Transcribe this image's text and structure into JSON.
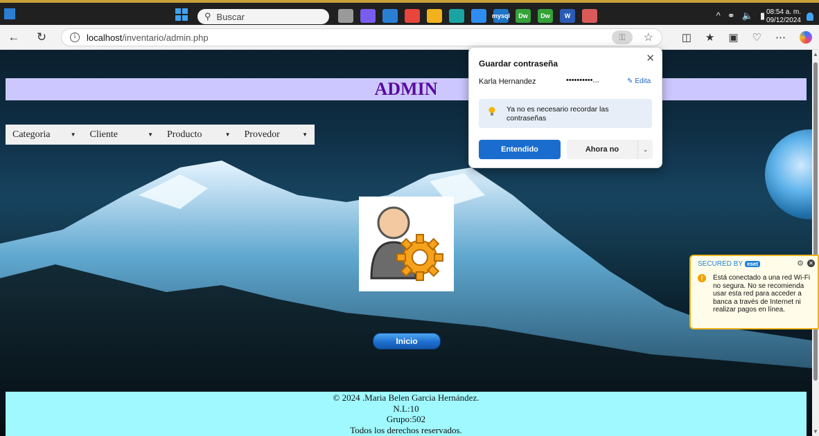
{
  "taskbar": {
    "search_placeholder": "Buscar",
    "clock_time": "08:54 a. m.",
    "clock_date": "09/12/2024",
    "apps": [
      {
        "name": "task-view-icon",
        "color": "#9a9a9a",
        "label": ""
      },
      {
        "name": "copilot-app-icon",
        "color": "#7a5cf0",
        "label": ""
      },
      {
        "name": "store-icon",
        "color": "#2a7fd4",
        "label": ""
      },
      {
        "name": "chrome-icon",
        "color": "#e8453c",
        "label": ""
      },
      {
        "name": "explorer-icon",
        "color": "#f2b21e",
        "label": ""
      },
      {
        "name": "edge-icon",
        "color": "#1aa3a3",
        "label": ""
      },
      {
        "name": "copilot-badge-icon",
        "color": "#2e8cf0",
        "label": ""
      },
      {
        "name": "mysql-icon",
        "color": "#1f74c6",
        "label": "mysql"
      },
      {
        "name": "dreamweaver-icon",
        "color": "#35a23a",
        "label": "Dw"
      },
      {
        "name": "dreamweaver-icon-2",
        "color": "#35a23a",
        "label": "Dw"
      },
      {
        "name": "word-icon",
        "color": "#2b5cb5",
        "label": "W"
      },
      {
        "name": "paint-icon",
        "color": "#d85a5a",
        "label": ""
      }
    ]
  },
  "browser": {
    "url_host": "localhost",
    "url_path": "/inventario/admin.php"
  },
  "page": {
    "title": "ADMIN",
    "menu": [
      {
        "label": "Categoria"
      },
      {
        "label": "Cliente"
      },
      {
        "label": "Producto"
      },
      {
        "label": "Provedor"
      }
    ],
    "inicio_button": "Inicio",
    "footer": {
      "line1": "© 2024 .Maria Belen Garcia Hernández.",
      "line2": "N.L:10",
      "line3": "Grupo:502",
      "line4": "Todos los derechos reservados."
    }
  },
  "password_popup": {
    "title": "Guardar contraseña",
    "username": "Karla Hernandez",
    "password_mask": "••••••••••...",
    "edit_label": "Edita",
    "tip_text": "Ya no es necesario recordar las contraseñas",
    "ok_label": "Entendido",
    "no_label": "Ahora no"
  },
  "eset": {
    "header": "SECURED BY",
    "logo": "eset",
    "message": "Está conectado a una red Wi-Fi no segura. No se recomienda usar esta red para acceder a banca a través de Internet ni realizar pagos en línea."
  }
}
